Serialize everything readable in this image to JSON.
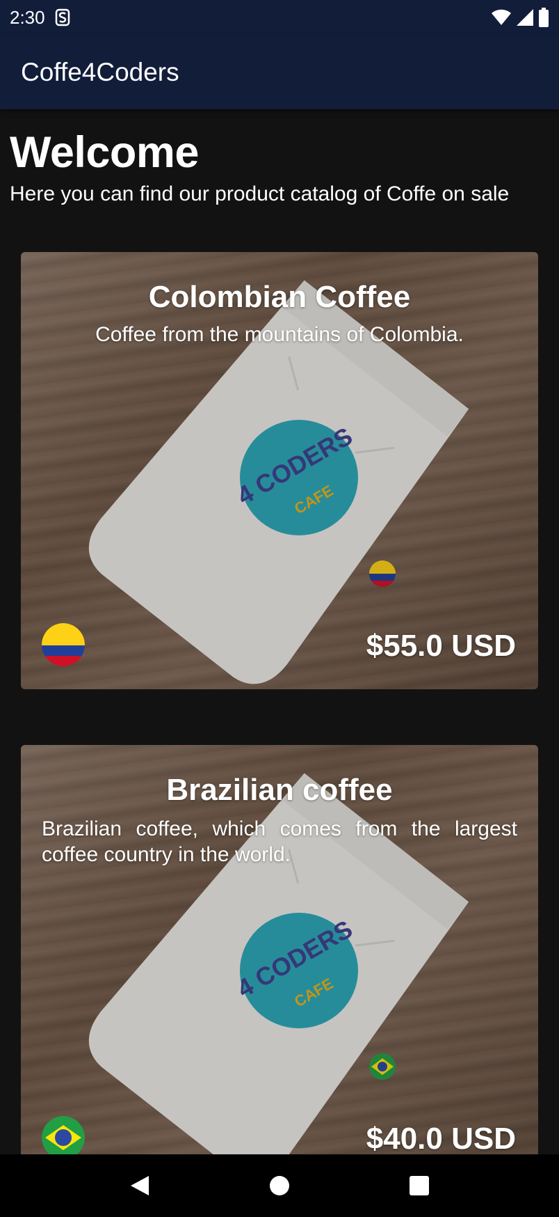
{
  "status_bar": {
    "time": "2:30",
    "icons": [
      "s-icon",
      "wifi-icon",
      "signal-icon",
      "battery-icon"
    ]
  },
  "app_bar": {
    "title": "Coffe4Coders"
  },
  "header": {
    "title": "Welcome",
    "subtitle": "Here you can find our product catalog of Coffe on sale"
  },
  "products": [
    {
      "title": "Colombian Coffee",
      "description": "Coffee from the mountains of Colombia.",
      "price": "$55.0 USD",
      "flag": "colombia-flag-icon",
      "logo_text": "4 CODERS",
      "logo_sub": "CAFE"
    },
    {
      "title": "Brazilian coffee",
      "description": "Brazilian coffee, which comes from the largest coffee country in the world.",
      "price": "$40.0 USD",
      "flag": "brazil-flag-icon",
      "logo_text": "4 CODERS",
      "logo_sub": "CAFE"
    }
  ],
  "nav_bar": {
    "buttons": [
      "back-icon",
      "home-icon",
      "recents-icon"
    ]
  },
  "colors": {
    "app_bar": "#121d3a",
    "background": "#121212",
    "logo_circle": "#2aa6b8",
    "logo_text": "#3b3f8f",
    "logo_sub": "#e6b21c"
  }
}
